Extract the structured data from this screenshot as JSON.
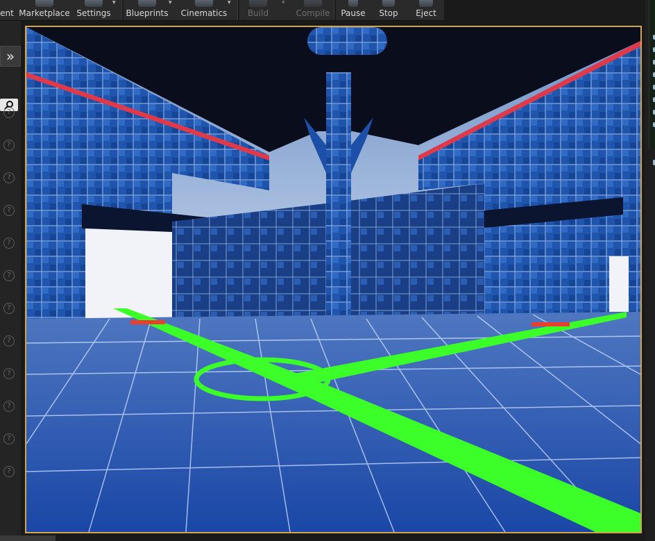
{
  "toolbar": {
    "items": [
      {
        "label": "ent",
        "enabled": true
      },
      {
        "label": "Marketplace",
        "enabled": true
      },
      {
        "label": "Settings",
        "enabled": true
      },
      {
        "label": "Blueprints",
        "enabled": true
      },
      {
        "label": "Cinematics",
        "enabled": true
      },
      {
        "label": "Build",
        "enabled": false
      },
      {
        "label": "Compile",
        "enabled": false
      },
      {
        "label": "Pause",
        "enabled": true
      },
      {
        "label": "Stop",
        "enabled": true
      },
      {
        "label": "Eject",
        "enabled": true
      }
    ]
  },
  "left_panel": {
    "expand_icon": "double-chevron-right-icon",
    "search_icon": "search-icon",
    "help_icon": "question-icon",
    "help_glyph": "?"
  },
  "viewport": {
    "scene": "tiled blue level with green navigation mesh path",
    "accent_border": "#d3a54a",
    "nav_path_color": "#3cff2a",
    "tile_color": "#1c4fa8"
  }
}
